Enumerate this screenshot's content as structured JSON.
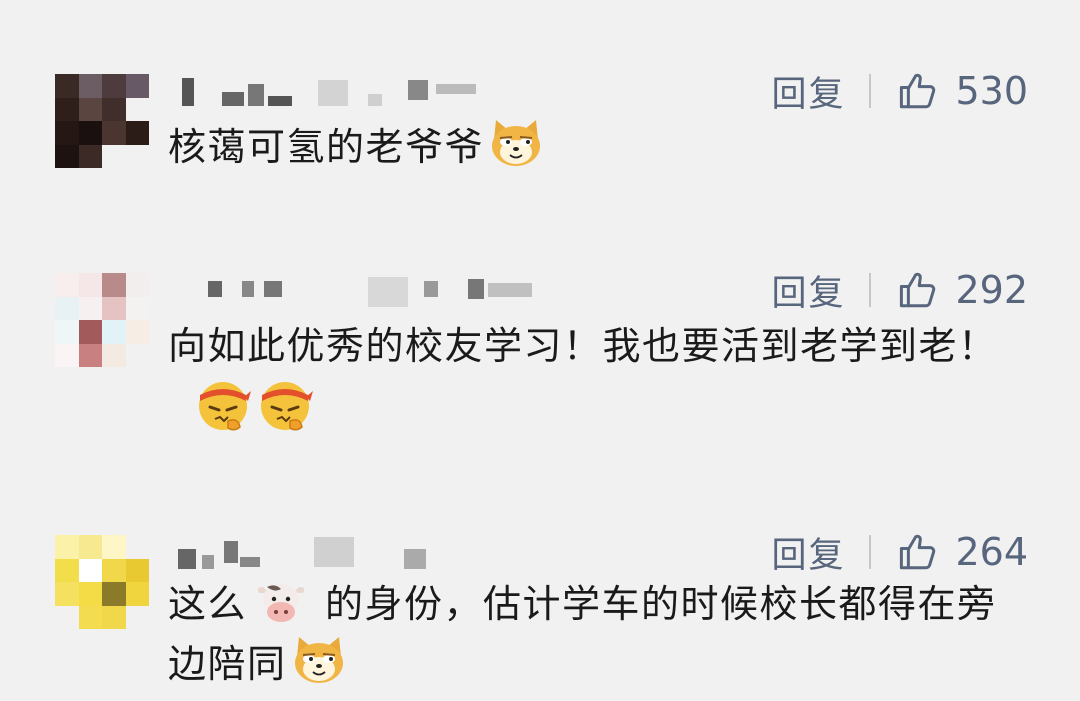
{
  "comments": [
    {
      "reply_label": "回复",
      "like_count": "530",
      "text_parts": [
        "核蔼可氢的老爷爷"
      ],
      "emoji_names": [
        "doge-icon"
      ]
    },
    {
      "reply_label": "回复",
      "like_count": "292",
      "text_parts": [
        "向如此优秀的校友学习！我也要活到老学到老！"
      ],
      "emoji_names": [
        "determined-face-icon",
        "determined-face-icon"
      ]
    },
    {
      "reply_label": "回复",
      "like_count": "264",
      "text_parts": [
        "这么",
        "的身份，估计学车的时候校长都得在旁边陪同"
      ],
      "emoji_names": [
        "cow-face-icon",
        "doge-icon"
      ]
    }
  ],
  "icons": {
    "like": "thumbs-up-icon",
    "avatar": "pixelated-avatar"
  },
  "colors": {
    "background": "#f1f1f1",
    "action_text": "#57657d",
    "body_text": "#1a1a1a"
  }
}
